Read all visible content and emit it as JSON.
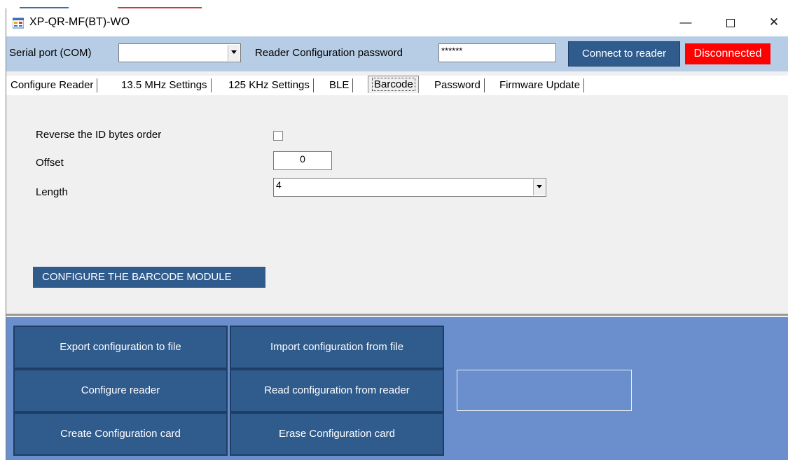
{
  "window": {
    "title": "XP-QR-MF(BT)-WO",
    "controls": {
      "minimize": "—",
      "maximize": "",
      "close": "✕"
    },
    "icon": "app-window-icon"
  },
  "connection": {
    "serial_port_label": "Serial port (COM)",
    "serial_port_value": "",
    "password_label": "Reader Configuration password",
    "password_value": "******",
    "connect_label": "Connect to reader",
    "status": "Disconnected",
    "status_color": "#ff0000"
  },
  "tabs": [
    {
      "label": "Configure Reader"
    },
    {
      "label": "13.5 MHz Settings"
    },
    {
      "label": "125 KHz Settings"
    },
    {
      "label": "BLE"
    },
    {
      "label": "Barcode",
      "active": true
    },
    {
      "label": "Password"
    },
    {
      "label": "Firmware Update"
    }
  ],
  "barcode": {
    "reverse_label": "Reverse the ID bytes order",
    "reverse_checked": false,
    "offset_label": "Offset",
    "offset_value": "0",
    "length_label": "Length",
    "length_value": "4",
    "configure_button": "CONFIGURE THE BARCODE MODULE"
  },
  "actions": {
    "export": "Export configuration to file",
    "import": "Import configuration from file",
    "configure_reader": "Configure reader",
    "read_config": "Read configuration from reader",
    "create_card": "Create Configuration card",
    "erase_card": "Erase Configuration card"
  },
  "colors": {
    "accent_button": "#2f5b8d",
    "connection_bar": "#b7cde6",
    "bottom_panel": "#6a8fcc"
  }
}
